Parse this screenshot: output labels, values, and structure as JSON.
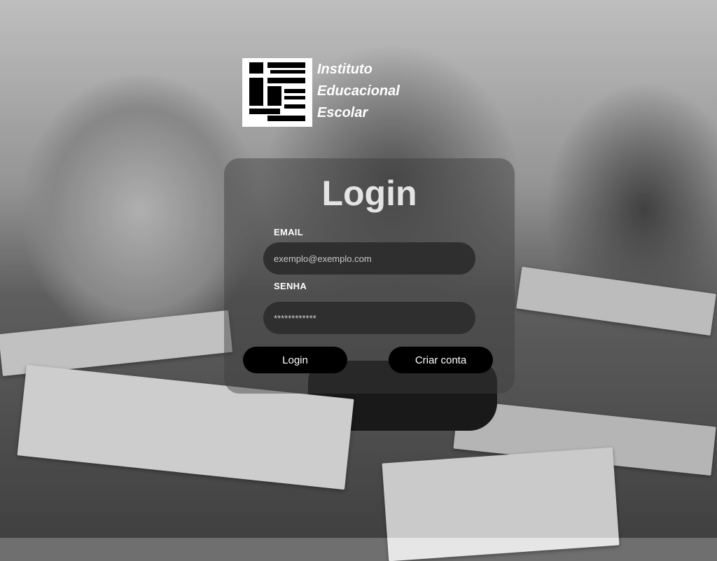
{
  "brand": {
    "line1": "Instituto",
    "line2": "Educacional",
    "line3": "Escolar",
    "logo_icon": "iee-logo-icon"
  },
  "login": {
    "title": "Login",
    "email_label": "EMAIL",
    "email_placeholder": "exemplo@exemplo.com",
    "email_value": "",
    "password_label": "SENHA",
    "password_value": "************",
    "login_button": "Login",
    "create_account_button": "Criar conta"
  },
  "colors": {
    "card_bg": "#3c3c3c",
    "field_bg": "#2f2f2f",
    "button_bg": "#000000",
    "text": "#ffffff"
  }
}
